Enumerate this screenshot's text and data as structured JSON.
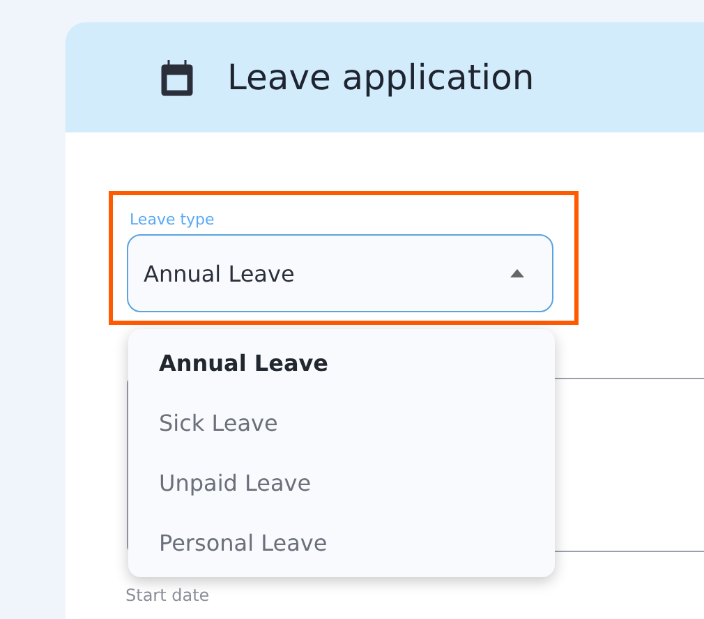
{
  "card": {
    "title": "Leave application"
  },
  "leave_type": {
    "label": "Leave type",
    "value": "Annual Leave",
    "expanded": true,
    "highlighted": true,
    "options": [
      {
        "label": "Annual Leave",
        "selected": true
      },
      {
        "label": "Sick Leave",
        "selected": false
      },
      {
        "label": "Unpaid Leave",
        "selected": false
      },
      {
        "label": "Personal Leave",
        "selected": false
      }
    ]
  },
  "start_date": {
    "label": "Start date"
  }
}
